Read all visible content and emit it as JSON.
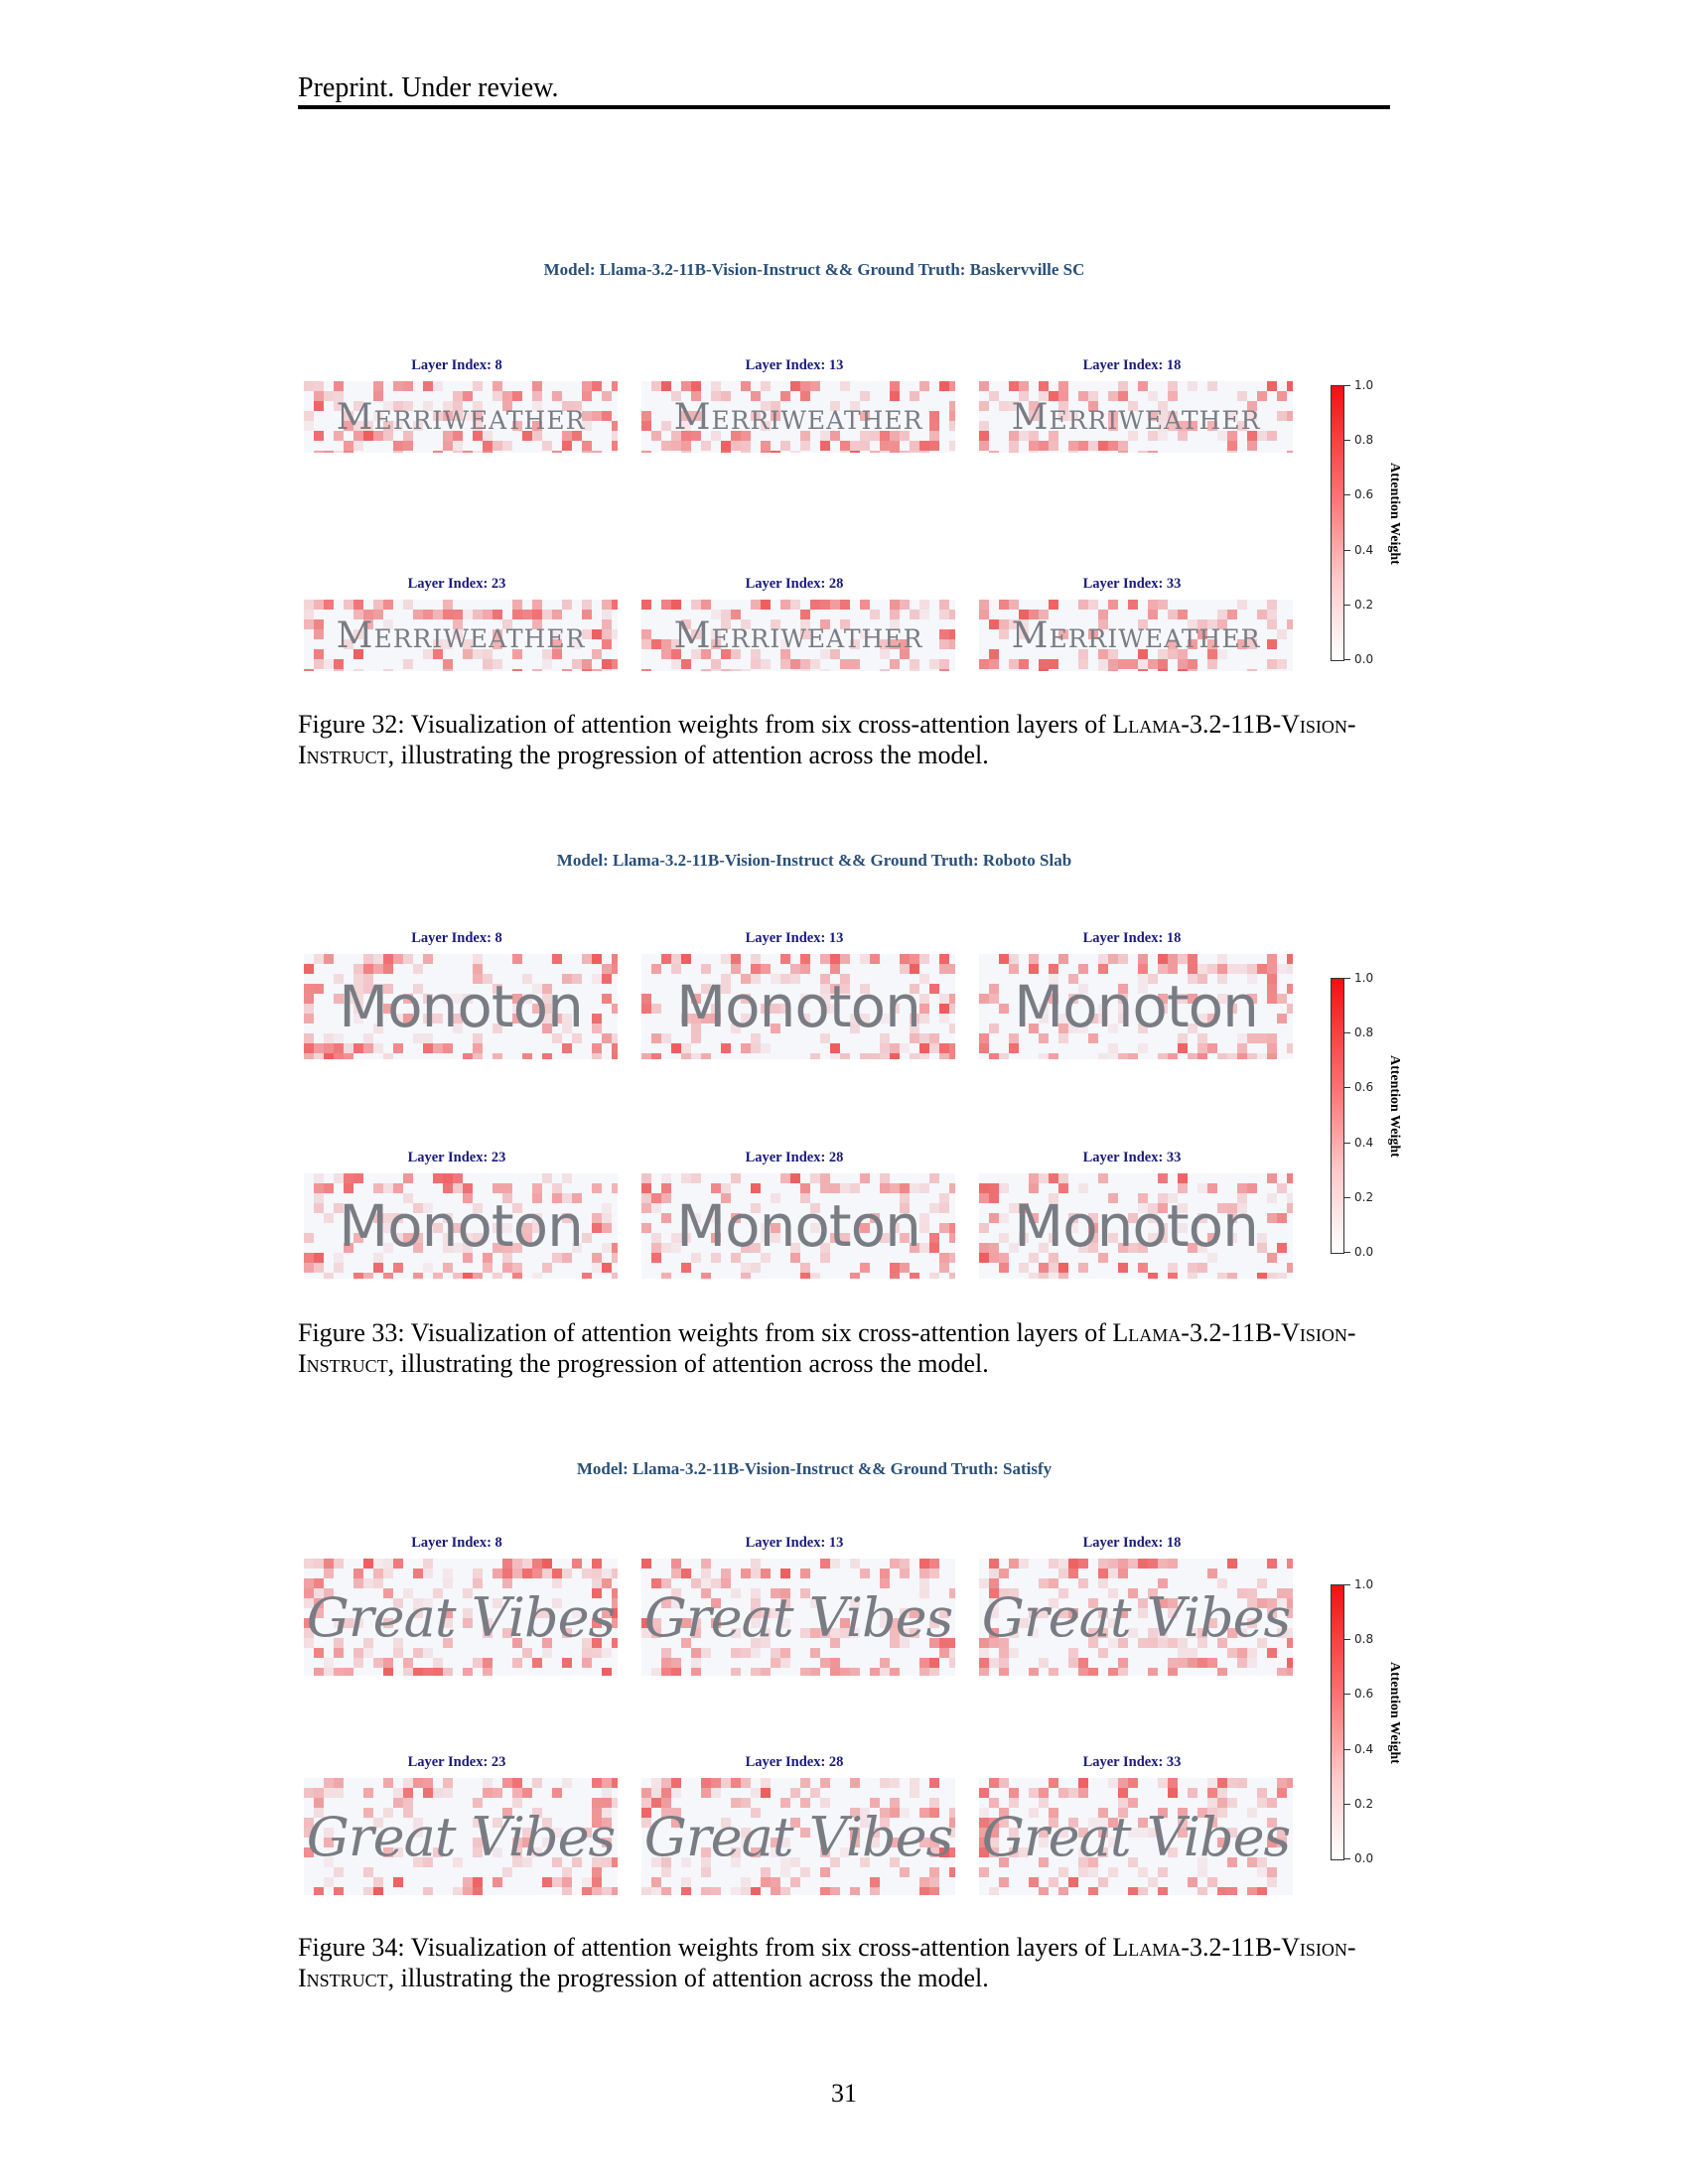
{
  "header": {
    "text": "Preprint. Under review."
  },
  "figures": [
    {
      "title": "Model: Llama-3.2-11B-Vision-Instruct && Ground Truth: Baskervville SC",
      "word": "Merriweather",
      "panels": [
        {
          "label": "Layer Index: 8"
        },
        {
          "label": "Layer Index: 13"
        },
        {
          "label": "Layer Index: 18"
        },
        {
          "label": "Layer Index: 23"
        },
        {
          "label": "Layer Index: 28"
        },
        {
          "label": "Layer Index: 33"
        }
      ],
      "colorbar": {
        "label": "Attention Weight",
        "ticks": [
          "1.0",
          "0.8",
          "0.6",
          "0.4",
          "0.2",
          "0.0"
        ]
      },
      "caption": {
        "prefix": "Figure 32: Visualization of attention weights from six cross-attention layers of ",
        "model": "Llama-3.2-11B-Vision-Instruct",
        "suffix": ", illustrating the progression of attention across the model."
      }
    },
    {
      "title": "Model: Llama-3.2-11B-Vision-Instruct && Ground Truth: Roboto Slab",
      "word": "Monoton",
      "panels": [
        {
          "label": "Layer Index: 8"
        },
        {
          "label": "Layer Index: 13"
        },
        {
          "label": "Layer Index: 18"
        },
        {
          "label": "Layer Index: 23"
        },
        {
          "label": "Layer Index: 28"
        },
        {
          "label": "Layer Index: 33"
        }
      ],
      "colorbar": {
        "label": "Attention Weight",
        "ticks": [
          "1.0",
          "0.8",
          "0.6",
          "0.4",
          "0.2",
          "0.0"
        ]
      },
      "caption": {
        "prefix": "Figure 33: Visualization of attention weights from six cross-attention layers of ",
        "model": "Llama-3.2-11B-Vision-Instruct",
        "suffix": ", illustrating the progression of attention across the model."
      }
    },
    {
      "title": "Model: Llama-3.2-11B-Vision-Instruct && Ground Truth: Satisfy",
      "word": "Great Vibes",
      "panels": [
        {
          "label": "Layer Index: 8"
        },
        {
          "label": "Layer Index: 13"
        },
        {
          "label": "Layer Index: 18"
        },
        {
          "label": "Layer Index: 23"
        },
        {
          "label": "Layer Index: 28"
        },
        {
          "label": "Layer Index: 33"
        }
      ],
      "colorbar": {
        "label": "Attention Weight",
        "ticks": [
          "1.0",
          "0.8",
          "0.6",
          "0.4",
          "0.2",
          "0.0"
        ]
      },
      "caption": {
        "prefix": "Figure 34: Visualization of attention weights from six cross-attention layers of ",
        "model": "Llama-3.2-11B-Vision-Instruct",
        "suffix": ", illustrating the progression of attention across the model."
      }
    }
  ],
  "page_number": "31"
}
